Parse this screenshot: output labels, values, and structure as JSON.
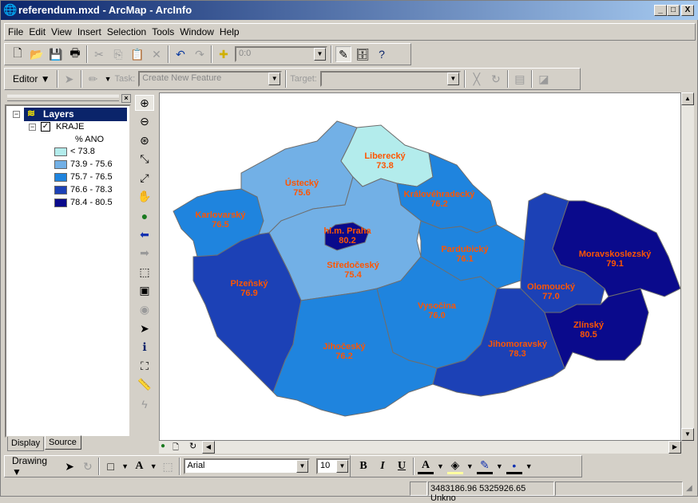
{
  "window": {
    "title": "referendum.mxd - ArcMap - ArcInfo",
    "min": "_",
    "max": "□",
    "close": "X"
  },
  "menu": [
    "File",
    "Edit",
    "View",
    "Insert",
    "Selection",
    "Tools",
    "Window",
    "Help"
  ],
  "standard_toolbar": {
    "scale_value": "0:0"
  },
  "editor_toolbar": {
    "editor_label": "Editor",
    "task_label": "Task:",
    "task_value": "Create New Feature",
    "target_label": "Target:",
    "target_value": ""
  },
  "toc": {
    "root": "Layers",
    "layer": "KRAJE",
    "field": "% ANO",
    "classes": [
      {
        "label": "< 73.8",
        "color": "#b3ecec"
      },
      {
        "label": "73.9 - 75.6",
        "color": "#72b0e6"
      },
      {
        "label": "75.7 - 76.5",
        "color": "#1f84de"
      },
      {
        "label": "76.6 - 78.3",
        "color": "#1c41b6"
      },
      {
        "label": "78.4 - 80.5",
        "color": "#0a0a8c"
      }
    ],
    "tabs": [
      "Display",
      "Source"
    ]
  },
  "map": {
    "label_color": "#ff5500",
    "regions": [
      {
        "name": "Karlovarský",
        "value": "76.5",
        "class": 2
      },
      {
        "name": "Ústecký",
        "value": "75.6",
        "class": 1
      },
      {
        "name": "Liberecký",
        "value": "73.8",
        "class": 0
      },
      {
        "name": "Královéhradecký",
        "value": "76.2",
        "class": 2
      },
      {
        "name": "Pardubický",
        "value": "76.1",
        "class": 2
      },
      {
        "name": "Středočeský",
        "value": "75.4",
        "class": 1
      },
      {
        "name": "hl.m. Praha",
        "value": "80.2",
        "class": 4
      },
      {
        "name": "Plzeňský",
        "value": "76.9",
        "class": 3
      },
      {
        "name": "Jihočeský",
        "value": "76.2",
        "class": 2
      },
      {
        "name": "Vysočina",
        "value": "76.0",
        "class": 2
      },
      {
        "name": "Jihomoravský",
        "value": "78.3",
        "class": 3
      },
      {
        "name": "Olomoucký",
        "value": "77.0",
        "class": 3
      },
      {
        "name": "Moravskoslezský",
        "value": "79.1",
        "class": 4
      },
      {
        "name": "Zlínský",
        "value": "80.5",
        "class": 4
      }
    ]
  },
  "drawing_toolbar": {
    "drawing_label": "Drawing",
    "font": "Arial",
    "size": "10",
    "bold": "B",
    "italic": "I",
    "underline": "U"
  },
  "status": {
    "coords": "3483186.96  5325926.65 Unkno"
  }
}
